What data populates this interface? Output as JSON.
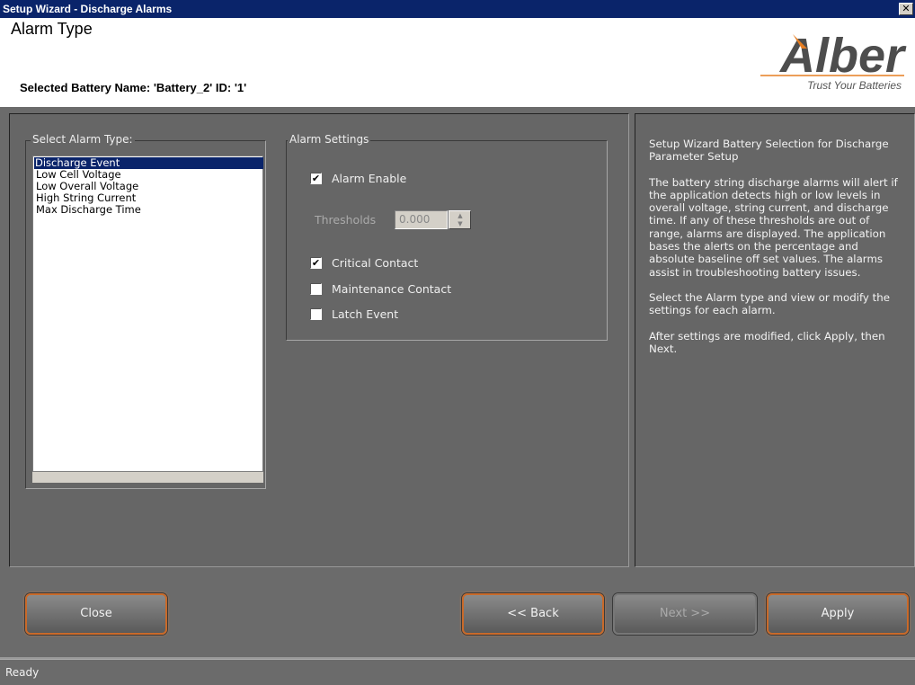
{
  "window": {
    "title": "Setup Wizard - Discharge Alarms",
    "close_glyph": "✕"
  },
  "header": {
    "page_title": "Alarm Type",
    "battery_line": "Selected Battery Name: 'Battery_2' ID: '1'",
    "logo": {
      "brand": "Alber",
      "tagline": "Trust Your Batteries",
      "color": "#4d4d4d",
      "accent": "#e67e22"
    }
  },
  "alarm_types": {
    "legend": "Select Alarm Type:",
    "items": [
      {
        "label": "Discharge Event",
        "selected": true
      },
      {
        "label": "Low Cell Voltage",
        "selected": false
      },
      {
        "label": "Low Overall Voltage",
        "selected": false
      },
      {
        "label": "High String Current",
        "selected": false
      },
      {
        "label": "Max Discharge Time",
        "selected": false
      }
    ]
  },
  "settings": {
    "legend": "Alarm Settings",
    "alarm_enable": {
      "label": "Alarm Enable",
      "checked": true
    },
    "thresholds": {
      "label": "Thresholds",
      "value": "0.000",
      "disabled": true
    },
    "critical_contact": {
      "label": "Critical Contact",
      "checked": true
    },
    "maintenance_contact": {
      "label": "Maintenance Contact",
      "checked": false
    },
    "latch_event": {
      "label": "Latch Event",
      "checked": false
    }
  },
  "help": {
    "paragraphs": [
      "Setup Wizard Battery Selection for Discharge Parameter Setup",
      "The battery string discharge alarms will alert if the application detects high or low levels in overall voltage, string current, and discharge time. If any of these thresholds are out of range, alarms are displayed. The application bases the alerts on the percentage and absolute baseline off set values. The alarms assist in troubleshooting battery issues.",
      "Select the Alarm type and view or modify the settings for each alarm.",
      "After settings are modified, click Apply, then Next."
    ]
  },
  "buttons": {
    "close": "Close",
    "back": "<< Back",
    "next": "Next >>",
    "apply": "Apply"
  },
  "status": {
    "text": "Ready"
  }
}
